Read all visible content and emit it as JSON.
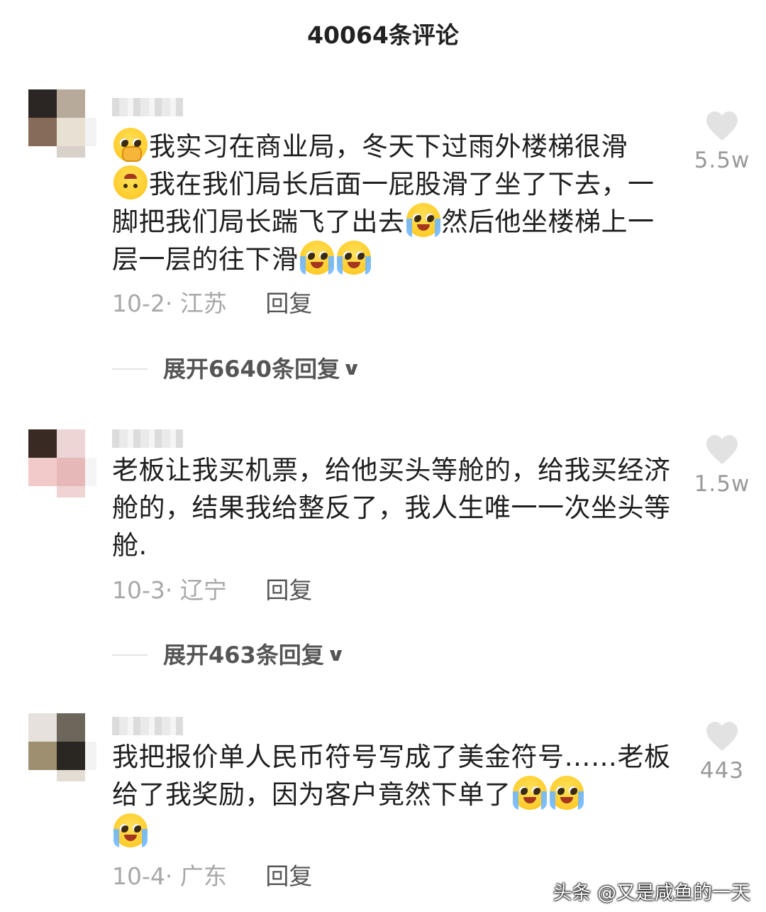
{
  "header": {
    "title": "40064条评论"
  },
  "comments": [
    {
      "text_parts": [
        "我实习在商业局，冬天下过雨外楼梯很滑",
        "我在我们局长后面一屁股滑了坐了下去，一脚把我们局长踹飞了出去",
        "然后他坐楼梯上一层一层的往下滑"
      ],
      "date": "10-2",
      "region": "江苏",
      "reply_label": "回复",
      "expand_label": "展开6640条回复",
      "likes": "5.5w"
    },
    {
      "text": "老板让我买机票，给他买头等舱的，给我买经济舱的，结果我给整反了，我人生唯一一次坐头等舱.",
      "date": "10-3",
      "region": "辽宁",
      "reply_label": "回复",
      "expand_label": "展开463条回复",
      "likes": "1.5w"
    },
    {
      "text": "我把报价单人民币符号写成了美金符号……老板给了我奖励，因为客户竟然下单了",
      "date": "10-4",
      "region": "广东",
      "reply_label": "回复",
      "likes": "443"
    }
  ],
  "icons": {
    "like": "heart-icon",
    "expand": "chevron-down-icon",
    "emoji_cry": "crying-face-icon",
    "emoji_shy": "shy-face-icon",
    "emoji_upside": "upside-down-face-icon"
  },
  "colors": {
    "text": "#1f1f1f",
    "meta": "#a8a8a8",
    "heart": "#e0e0e0"
  },
  "watermark": "头条 @又是咸鱼的一天"
}
